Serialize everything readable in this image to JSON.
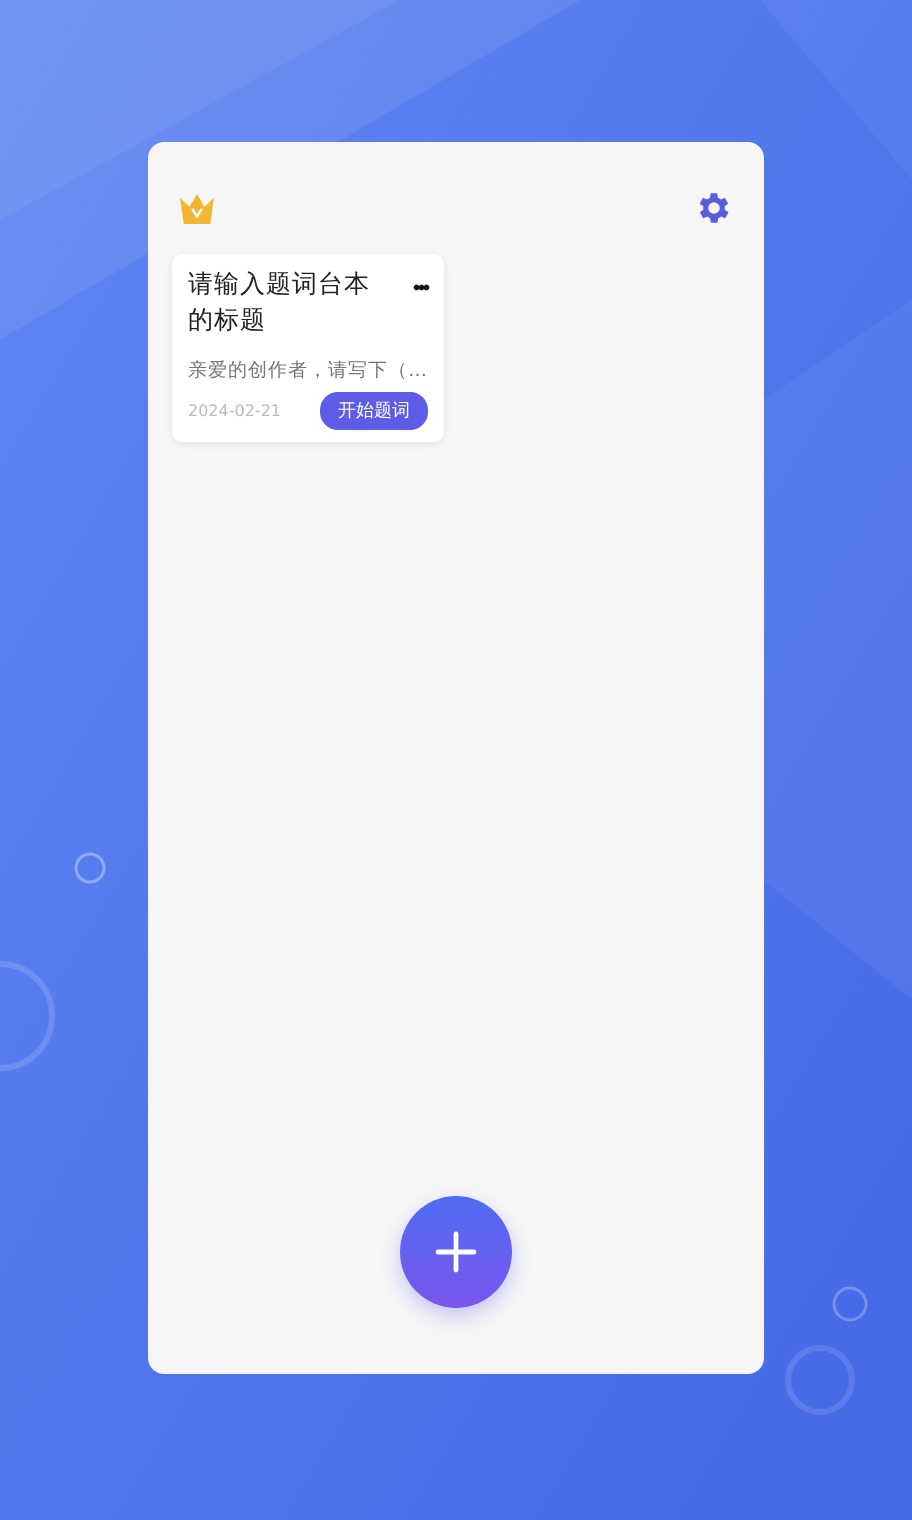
{
  "scripts": [
    {
      "title": "请输入题词台本的标题",
      "preview": "亲爱的创作者，请写下（…",
      "date": "2024-02-21",
      "action": "开始题词",
      "menu": "•••"
    }
  ]
}
